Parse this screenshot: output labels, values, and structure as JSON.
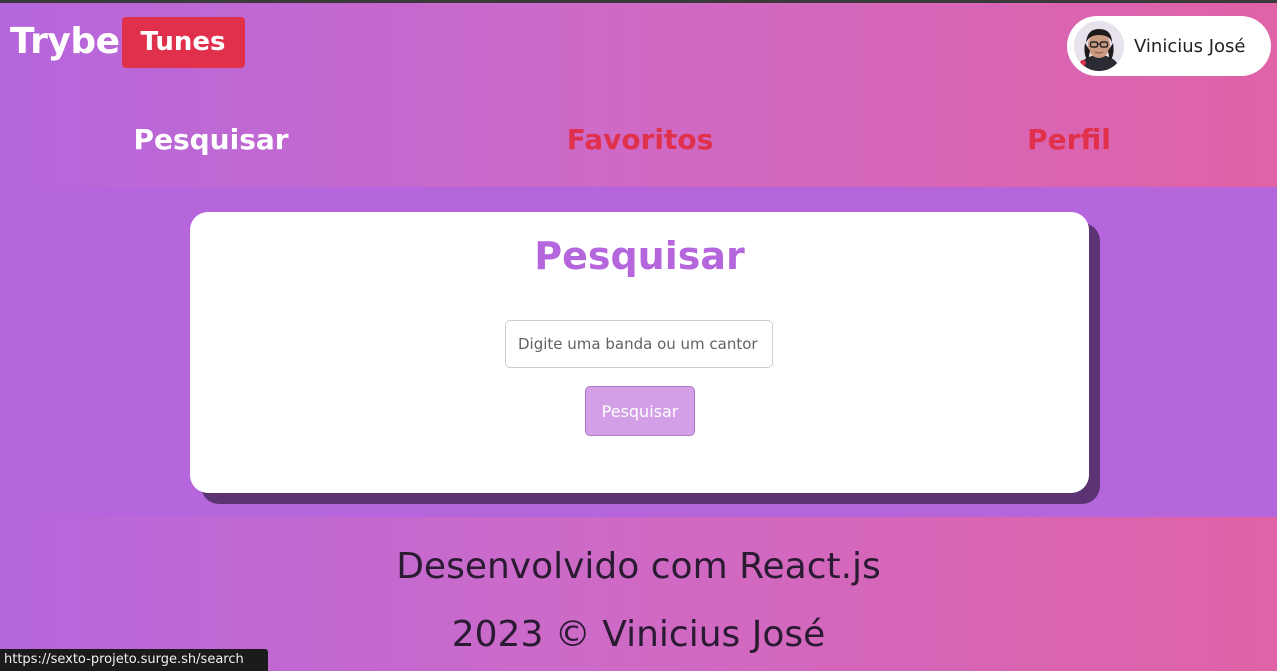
{
  "header": {
    "logo_trybe": "Trybe",
    "logo_tunes": "Tunes",
    "user_name": "Vinicius José"
  },
  "nav": {
    "search": "Pesquisar",
    "favorites": "Favoritos",
    "profile": "Perfil"
  },
  "search": {
    "title": "Pesquisar",
    "placeholder": "Digite uma banda ou um cantor",
    "button_label": "Pesquisar"
  },
  "footer": {
    "line1": "Desenvolvido com React.js",
    "line2": "2023 © Vinicius José"
  },
  "status_bar": {
    "url": "https://sexto-projeto.surge.sh/search"
  },
  "colors": {
    "brand_purple": "#b566dc",
    "brand_pink": "#e062a7",
    "accent_red": "#e0304b",
    "button_light_purple": "#d3a0e8"
  }
}
